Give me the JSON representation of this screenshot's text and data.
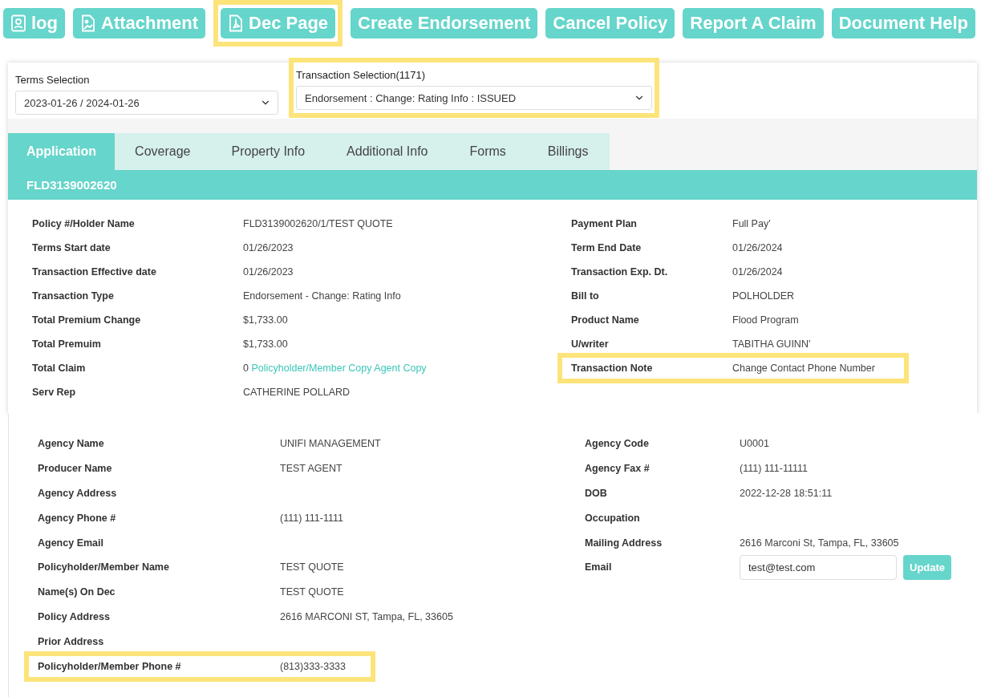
{
  "toolbar": {
    "buttons": [
      {
        "label": "log",
        "kind": "contact",
        "highlighted": false
      },
      {
        "label": "Attachment",
        "kind": "image",
        "highlighted": false
      },
      {
        "label": "Dec Page",
        "kind": "pdf",
        "highlighted": true
      },
      {
        "label": "Create Endorsement",
        "highlighted": false
      },
      {
        "label": "Cancel Policy",
        "highlighted": false
      },
      {
        "label": "Report A Claim",
        "highlighted": false
      },
      {
        "label": "Document Help",
        "highlighted": false
      }
    ]
  },
  "selectors": [
    {
      "label": "Terms Selection",
      "value": "2023-01-26 / 2024-01-26",
      "highlighted": false
    },
    {
      "label": "Transaction Selection(1171)",
      "value": "Endorsement : Change: Rating Info : ISSUED",
      "highlighted": true
    }
  ],
  "tabs": [
    {
      "label": "Application",
      "selected": true
    },
    {
      "label": "Coverage",
      "selected": false
    },
    {
      "label": "Property Info",
      "selected": false
    },
    {
      "label": "Additional Info",
      "selected": false
    },
    {
      "label": "Forms",
      "selected": false
    },
    {
      "label": "Billings",
      "selected": false
    }
  ],
  "header": {
    "title": "FLD3139002620"
  },
  "policy_details": {
    "left": [
      {
        "label": "Policy #/Holder Name",
        "value": "FLD3139002620/1/TEST QUOTE"
      },
      {
        "label": "Terms Start date",
        "value": "01/26/2023"
      },
      {
        "label": "Transaction Effective date",
        "value": "01/26/2023"
      },
      {
        "label": "Transaction Type",
        "value": "Endorsement - Change: Rating Info"
      },
      {
        "label": "Total Premium Change",
        "value": "$1,733.00"
      },
      {
        "label": "Total Premuim",
        "value": "$1,733.00"
      },
      {
        "label": "Total Claim",
        "value": "0",
        "links": [
          "Policyholder/Member Copy",
          "Agent Copy"
        ]
      },
      {
        "label": "Serv Rep",
        "value": "CATHERINE POLLARD"
      }
    ],
    "right": [
      {
        "label": "Payment Plan",
        "value": "Full Pay'"
      },
      {
        "label": "Term End Date",
        "value": "01/26/2024"
      },
      {
        "label": "Transaction Exp. Dt.",
        "value": "01/26/2024"
      },
      {
        "label": "Bill to",
        "value": "POLHOLDER"
      },
      {
        "label": "Product Name",
        "value": "Flood Program"
      },
      {
        "label": "U/writer",
        "value": "TABITHA GUINN'"
      },
      {
        "label": "Transaction Note",
        "value": "Change Contact Phone Number",
        "highlighted": true
      }
    ]
  },
  "agency_details": {
    "left": [
      {
        "label": "Agency Name",
        "value": "UNIFI MANAGEMENT"
      },
      {
        "label": "Producer Name",
        "value": "TEST AGENT"
      },
      {
        "label": "Agency Address"
      },
      {
        "label": "Agency Phone #",
        "value": "(111) 111-1111"
      },
      {
        "label": "Agency Email"
      },
      {
        "label": "Policyholder/Member Name",
        "value": "TEST QUOTE"
      },
      {
        "label": "Name(s) On Dec",
        "value": "TEST QUOTE"
      },
      {
        "label": "Policy Address",
        "value": "2616 MARCONI ST, Tampa, FL, 33605"
      },
      {
        "label": "Prior Address"
      },
      {
        "label": "Policyholder/Member Phone #",
        "value": "(813)333-3333",
        "highlighted": true
      }
    ],
    "right": [
      {
        "label": "Agency Code",
        "value": "U0001"
      },
      {
        "label": "Agency Fax #",
        "value": "(111) 111-11111"
      },
      {
        "label": "DOB",
        "value": "2022-12-28 18:51:11"
      },
      {
        "label": "Occupation"
      },
      {
        "label": "Mailing Address",
        "value": "2616 Marconi St, Tampa, FL, 33605"
      },
      {
        "label": "Email",
        "kind": "field",
        "value": "test@test.com",
        "button": "Update"
      }
    ]
  }
}
